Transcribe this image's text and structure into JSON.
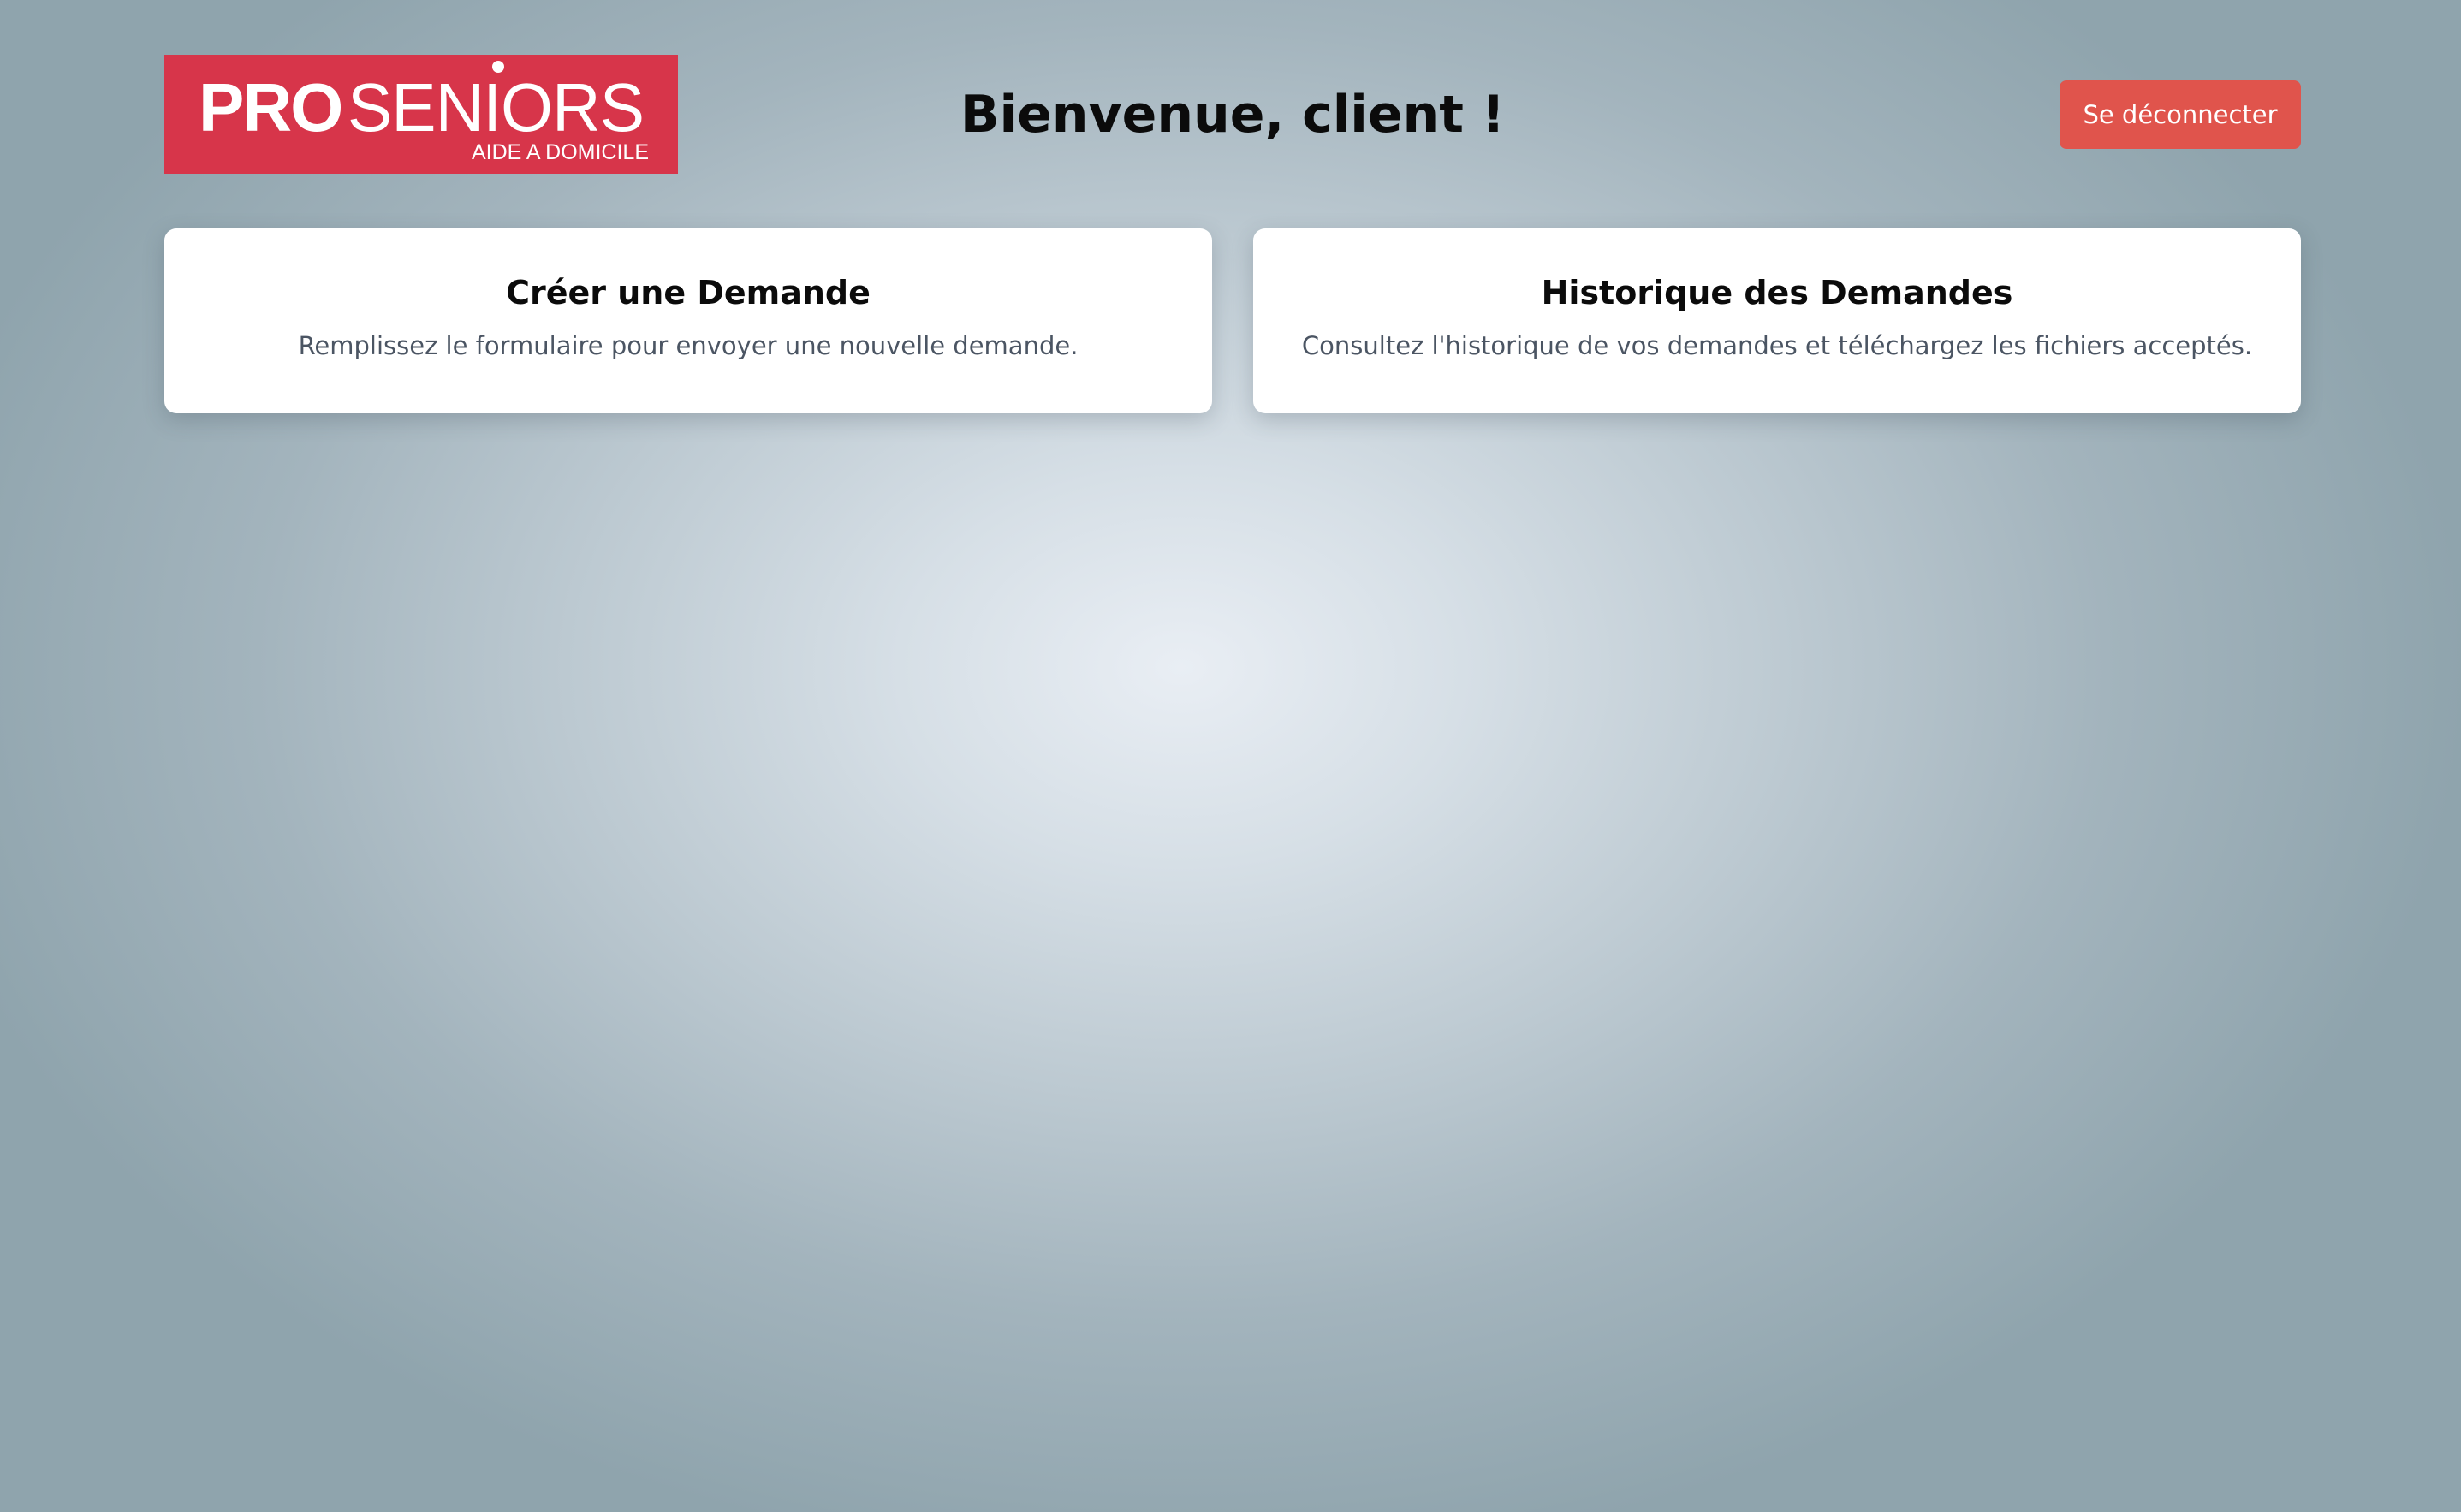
{
  "header": {
    "logo": {
      "brand_bold": "PRO",
      "brand_light": "SENIORS",
      "tagline": "AIDE A DOMICILE",
      "background_color": "#d7354a"
    },
    "title": "Bienvenue, client !",
    "logout_label": "Se déconnecter",
    "logout_color": "#e0544c"
  },
  "cards": [
    {
      "title": "Créer une Demande",
      "description": "Remplissez le formulaire pour envoyer une nouvelle demande."
    },
    {
      "title": "Historique des Demandes",
      "description": "Consultez l'historique de vos demandes et téléchargez les fichiers acceptés."
    }
  ]
}
